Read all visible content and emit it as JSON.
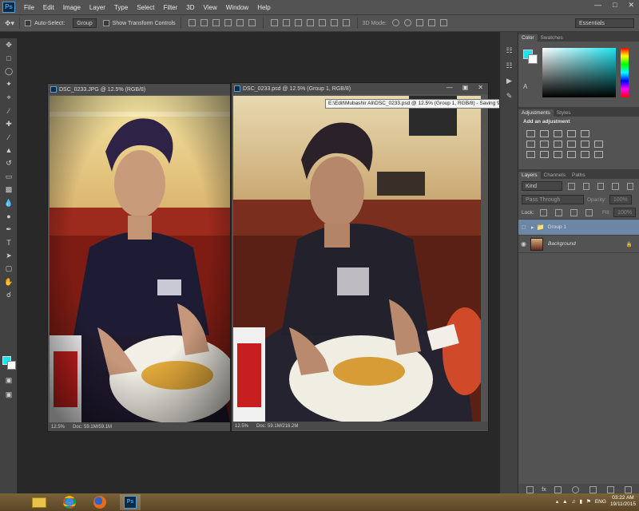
{
  "app": {
    "logo": "Ps"
  },
  "menubar": {
    "items": [
      "File",
      "Edit",
      "Image",
      "Layer",
      "Type",
      "Select",
      "Filter",
      "3D",
      "View",
      "Window",
      "Help"
    ]
  },
  "options": {
    "auto_select_label": "Auto-Select:",
    "auto_select_value": "Group",
    "show_transform_label": "Show Transform Controls",
    "mode_3d_label": "3D Mode:",
    "workspace_value": "Essentials"
  },
  "doc1": {
    "title": "DSC_0233.JPG @ 12.5% (RGB/8)",
    "zoom": "12.5%",
    "doc_size": "Doc: 59.1M/59.1M"
  },
  "doc2": {
    "title": "DSC_0233.psd @ 12.5% (Group 1, RGB/8)",
    "zoom": "12.5%",
    "doc_size": "Doc: 59.1M/216.2M"
  },
  "tooltip": {
    "text": "E:\\Edit\\Mubashir Ali\\DSC_0233.psd @ 12.5% (Group 1, RGB/8) - Saving 99%"
  },
  "panels": {
    "color_tabs": [
      "Color",
      "Swatches"
    ],
    "adj_tabs": [
      "Adjustments",
      "Styles"
    ],
    "add_adjustment": "Add an adjustment",
    "layer_tabs": [
      "Layers",
      "Channels",
      "Paths"
    ],
    "kind_value": "Kind",
    "blend_mode": "Pass Through",
    "opacity_label": "Opacity:",
    "opacity_value": "100%",
    "lock_label": "Lock:",
    "fill_label": "Fill:",
    "fill_value": "100%",
    "layers": [
      "Group 1",
      "Background"
    ]
  },
  "taskbar": {
    "lang": "ENG",
    "time": "03:22 AM",
    "date": "19/11/2015"
  },
  "colors": {
    "accent": "#2a9fd8",
    "foreground": "#1ee3ee",
    "background": "#ffffff",
    "taskbar": "#6a5530"
  }
}
